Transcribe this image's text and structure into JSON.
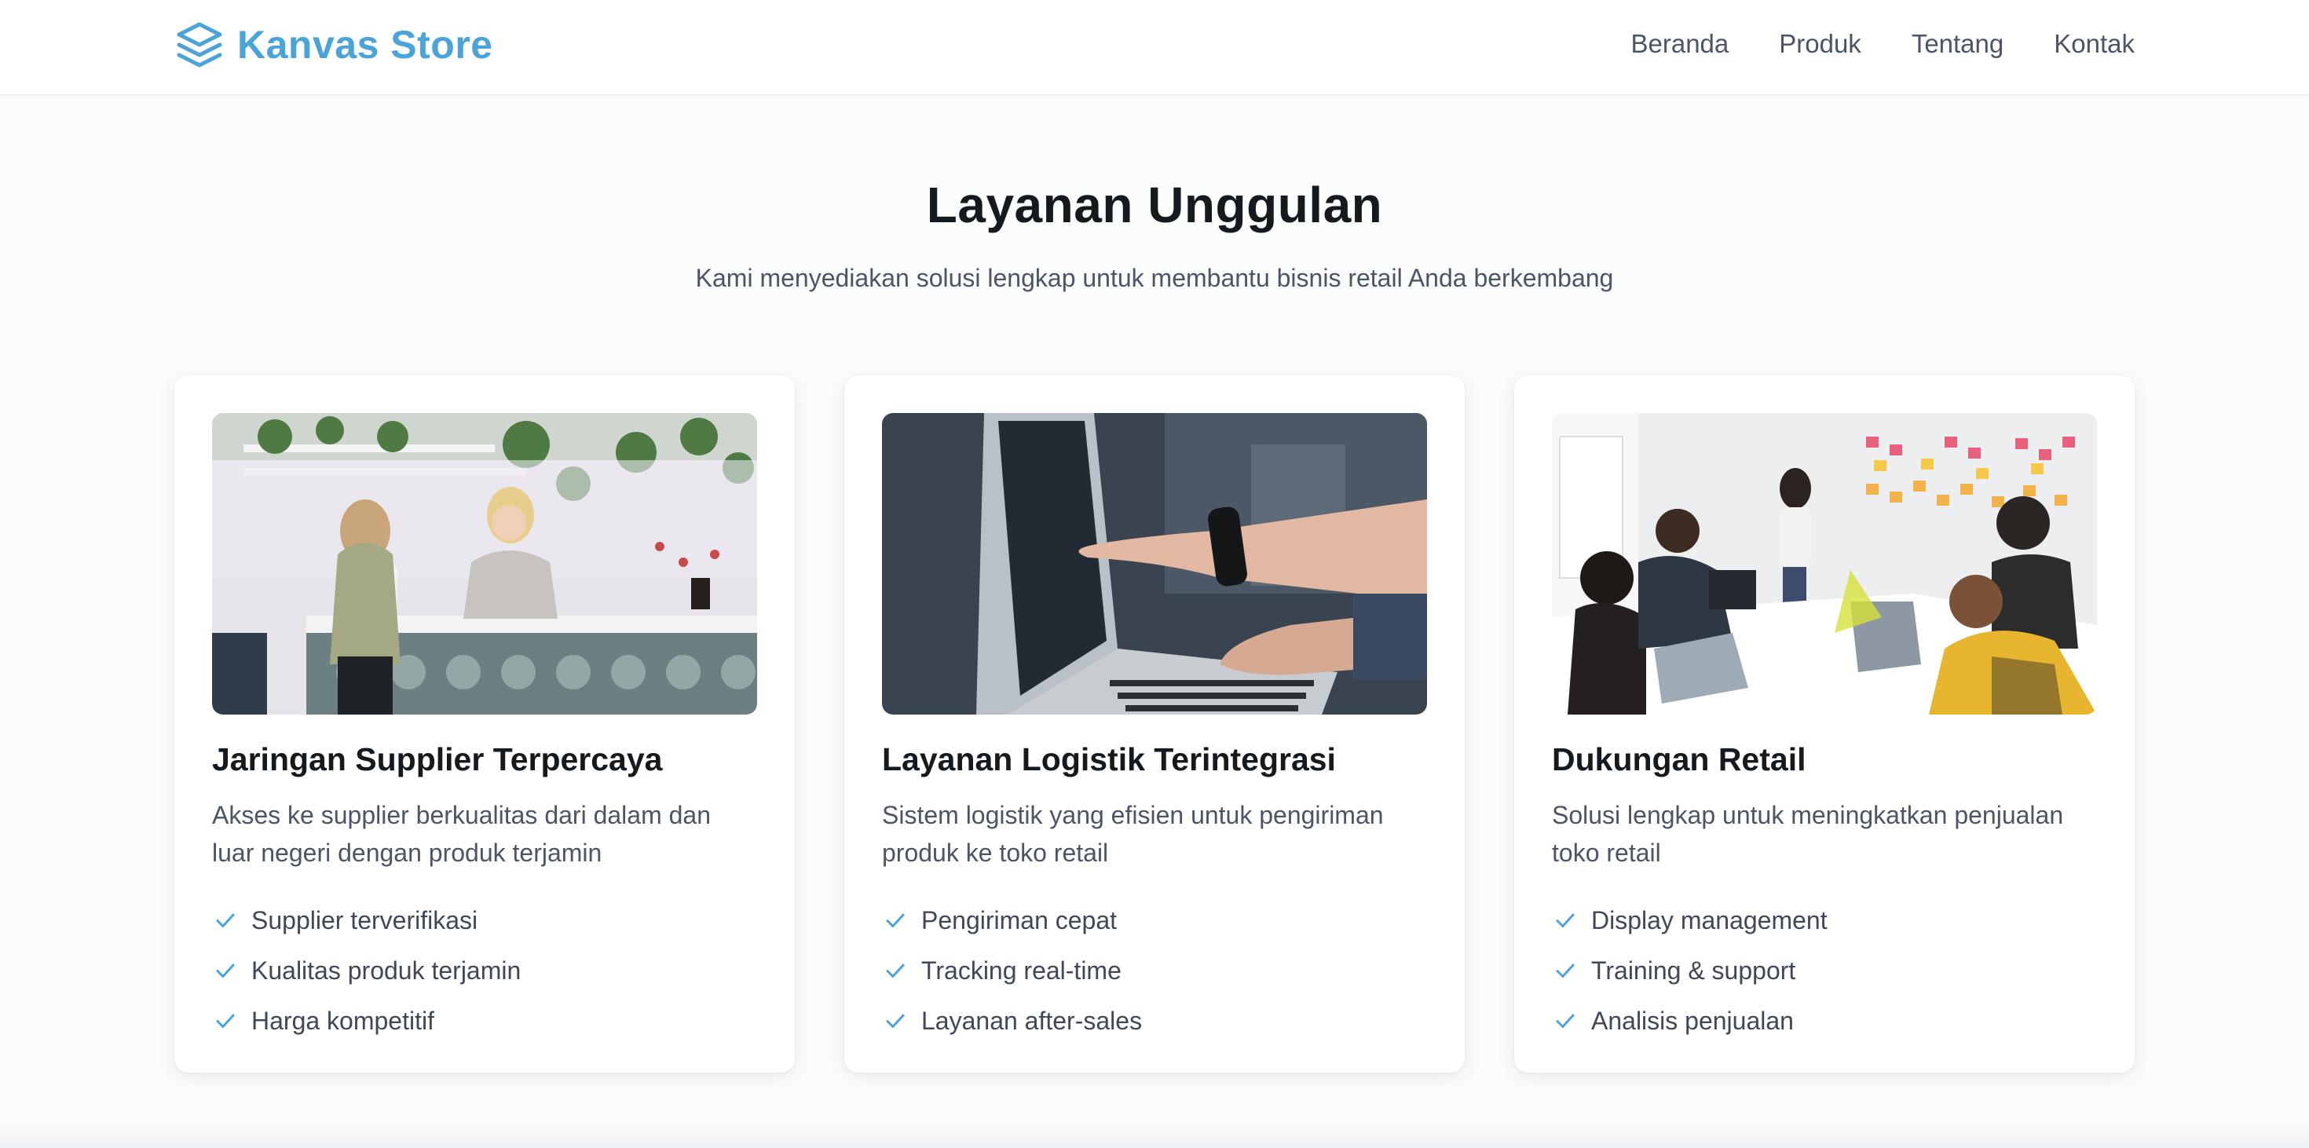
{
  "brand": {
    "name": "Kanvas Store",
    "icon": "layers-icon",
    "color": "#4aa3d9"
  },
  "nav": {
    "items": [
      "Beranda",
      "Produk",
      "Tentang",
      "Kontak"
    ]
  },
  "hero": {
    "title": "Layanan Unggulan",
    "subtitle": "Kami menyediakan solusi lengkap untuk membantu bisnis retail Anda berkembang"
  },
  "cards": [
    {
      "title": "Jaringan Supplier Terpercaya",
      "description": "Akses ke supplier berkualitas dari dalam dan luar negeri dengan produk terjamin",
      "features": [
        "Supplier terverifikasi",
        "Kualitas produk terjamin",
        "Harga kompetitif"
      ]
    },
    {
      "title": "Layanan Logistik Terintegrasi",
      "description": "Sistem logistik yang efisien untuk pengiriman produk ke toko retail",
      "features": [
        "Pengiriman cepat",
        "Tracking real-time",
        "Layanan after-sales"
      ]
    },
    {
      "title": "Dukungan Retail",
      "description": "Solusi lengkap untuk meningkatkan penjualan toko retail",
      "features": [
        "Display management",
        "Training & support",
        "Analisis penjualan"
      ]
    }
  ],
  "colors": {
    "accent": "#4aa3d9",
    "heading": "#151a1f",
    "body_text": "#4b5563"
  }
}
